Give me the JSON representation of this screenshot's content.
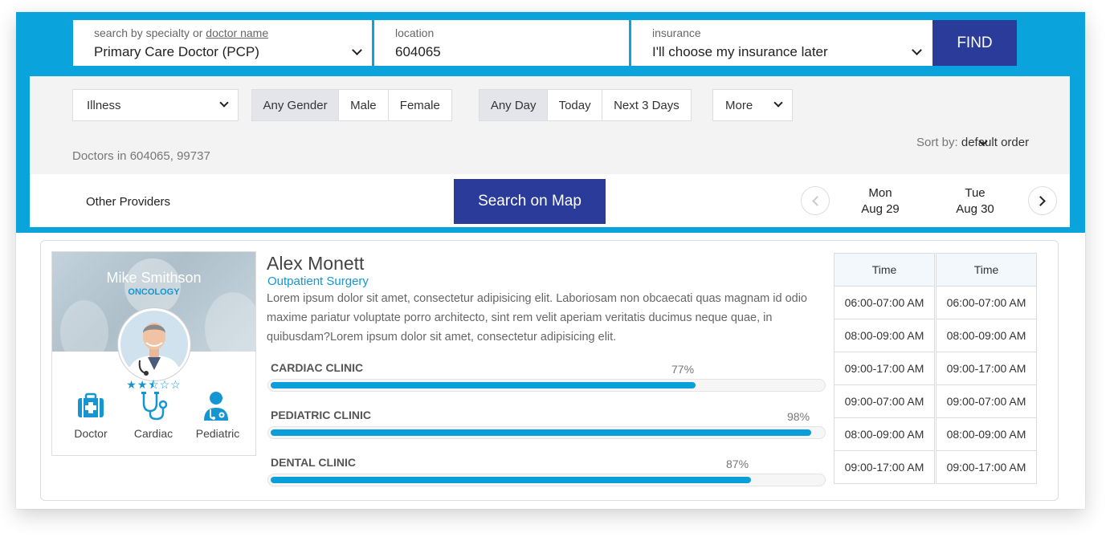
{
  "search": {
    "specialty_label_prefix": "search by specialty or ",
    "specialty_label_link": "doctor name",
    "specialty_value": "Primary Care Doctor (PCP)",
    "location_label": "location",
    "location_value": "604065",
    "insurance_label": "insurance",
    "insurance_value": "I'll choose my insurance later",
    "find_label": "FIND"
  },
  "filters": {
    "illness": "Illness",
    "gender_options": [
      "Any Gender",
      "Male",
      "Female"
    ],
    "gender_selected": "Any Gender",
    "day_options": [
      "Any Day",
      "Today",
      "Next 3 Days"
    ],
    "day_selected": "Any Day",
    "more": "More",
    "doctors_in": "Doctors in 604065, 99737",
    "sort_label": "Sort by:",
    "sort_value": "default order"
  },
  "nav": {
    "other_providers": "Other Providers",
    "search_on_map": "Search on Map",
    "days": [
      {
        "weekday": "Mon",
        "date": "Aug 29"
      },
      {
        "weekday": "Tue",
        "date": "Aug 30"
      }
    ]
  },
  "profile": {
    "name": "Mike Smithson",
    "specialty": "ONCOLOGY",
    "rating": 2.5,
    "stars_text": "★★⯪☆☆",
    "icons": [
      {
        "icon": "medical-kit-icon",
        "label": "Doctor"
      },
      {
        "icon": "stethoscope-icon",
        "label": "Cardiac"
      },
      {
        "icon": "doctor-person-icon",
        "label": "Pediatric"
      }
    ]
  },
  "doctor": {
    "name": "Alex Monett",
    "specialty": "Outpatient Surgery",
    "description": "Lorem ipsum dolor sit amet, consectetur adipisicing elit. Laboriosam non obcaecati quas magnam id odio maxime pariatur voluptate porro architecto, sint rem velit aperiam veritatis ducimus neque quae, in quibusdam?Lorem ipsum dolor sit amet, consectetur adipisicing elit.",
    "clinics": [
      {
        "name": "CARDIAC CLINIC",
        "percent_text": "77%",
        "percent": 77
      },
      {
        "name": "PEDIATRIC CLINIC",
        "percent_text": "98%",
        "percent": 98
      },
      {
        "name": "DENTAL CLINIC",
        "percent_text": "87%",
        "percent": 87
      }
    ]
  },
  "schedule": {
    "columns": [
      {
        "header": "Time",
        "slots": [
          "06:00-07:00 AM",
          "08:00-09:00 AM",
          "09:00-17:00 AM",
          "09:00-07:00 AM",
          "08:00-09:00 AM",
          "09:00-17:00 AM"
        ]
      },
      {
        "header": "Time",
        "slots": [
          "06:00-07:00 AM",
          "08:00-09:00 AM",
          "09:00-17:00 AM",
          "09:00-07:00 AM",
          "08:00-09:00 AM",
          "09:00-17:00 AM"
        ]
      }
    ]
  },
  "colors": {
    "accent_blue": "#0aa3dc",
    "button_navy": "#2a3b9a",
    "link_blue": "#1596d2"
  }
}
